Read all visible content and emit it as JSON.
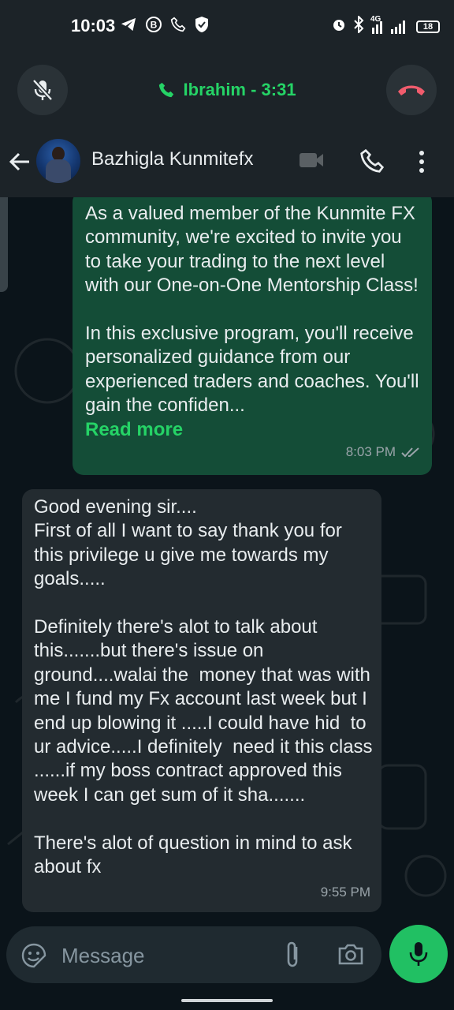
{
  "status_bar": {
    "time": "10:03",
    "network_label": "4G",
    "battery_level": "18",
    "left_icons": [
      "telegram-icon",
      "b-badge-icon",
      "phone-icon",
      "shield-icon"
    ],
    "right_icons": [
      "alarm-icon",
      "bluetooth-icon",
      "signal-icon",
      "battery-icon"
    ]
  },
  "call_banner": {
    "caller": "Ibrahim - 3:31",
    "accent_color": "#25d366",
    "end_call_color": "#f15c6d"
  },
  "chat_header": {
    "contact_name": "Bazhigla Kunmitefx"
  },
  "messages": [
    {
      "direction": "outgoing",
      "text": "As a valued member of the Kunmite FX community, we're excited to invite you to take your trading to the next level with our One-on-One Mentorship Class!\n\nIn this exclusive program, you'll receive personalized guidance from our experienced traders and coaches. You'll gain the confiden...",
      "read_more": "Read more",
      "time": "8:03 PM",
      "status": "read"
    },
    {
      "direction": "incoming",
      "text": "Good evening sir....\nFirst of all I want to say thank you for this privilege u give me towards my goals.....\n\nDefinitely there's alot to talk about this.......but there's issue on ground....walai the  money that was with me I fund my Fx account last week but I end up blowing it .....I could have hid  to ur advice.....I definitely  need it this class ......if my boss contract approved this week I can get sum of it sha.......\n\nThere's alot of question in mind to ask about fx",
      "time": "9:55 PM"
    }
  ],
  "input_bar": {
    "placeholder": "Message"
  }
}
